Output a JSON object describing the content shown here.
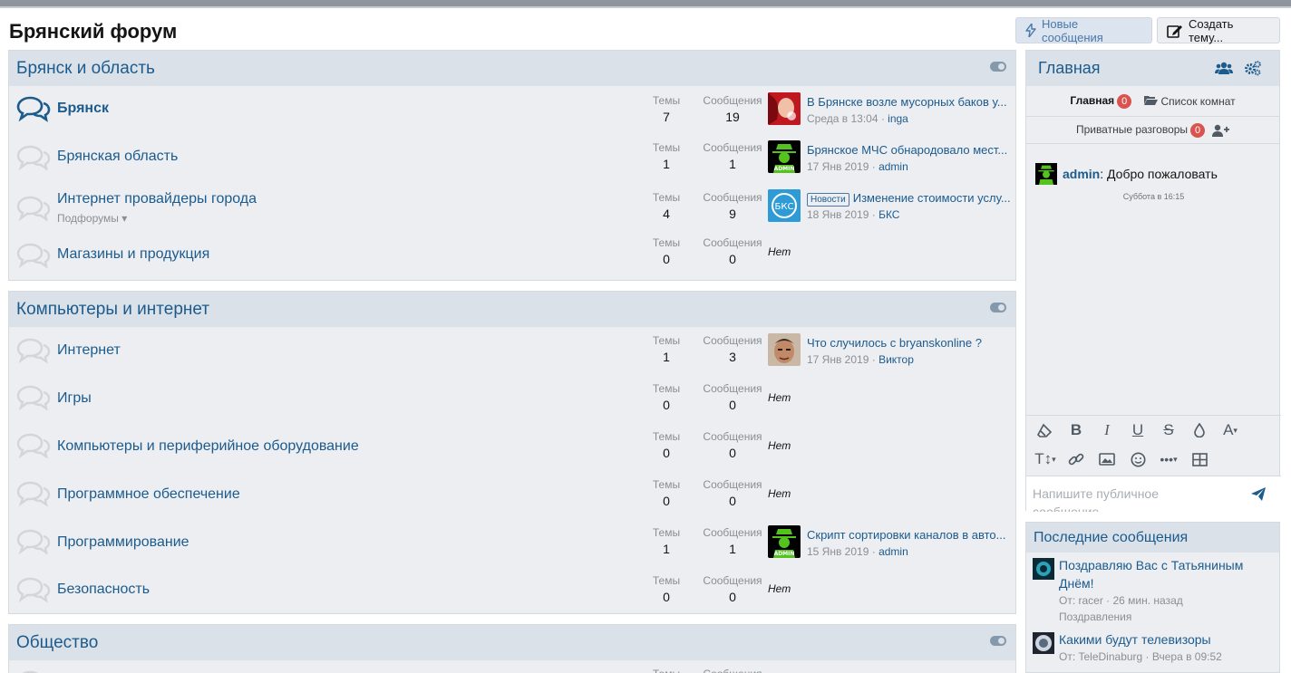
{
  "page": {
    "title": "Брянский форум"
  },
  "buttons": {
    "new_posts": "Новые сообщения",
    "create_thread": "Создать тему..."
  },
  "labels": {
    "threads": "Темы",
    "messages": "Сообщения",
    "none": "Нет"
  },
  "categories": [
    {
      "title": "Брянск и область",
      "nodes": [
        {
          "title": "Брянск",
          "unread": true,
          "threads": "7",
          "messages": "19",
          "last": {
            "title": "В Брянске возле мусорных баков у...",
            "date": "Среда в 13:04",
            "user": "inga",
            "avatar": "red-avatar"
          }
        },
        {
          "title": "Брянская область",
          "threads": "1",
          "messages": "1",
          "last": {
            "title": "Брянское МЧС обнародовало мест...",
            "date": "17 Янв 2019",
            "user": "admin",
            "avatar": "admin-avatar"
          }
        },
        {
          "title": "Интернет провайдеры города",
          "subforums": "Подфорумы",
          "threads": "4",
          "messages": "9",
          "last": {
            "prefix": "Новости",
            "title": "Изменение стоимости услу...",
            "date": "18 Янв 2019",
            "user": "БКС",
            "avatar": "bks-avatar",
            "avatar_text": "БКС"
          }
        },
        {
          "title": "Магазины и продукция",
          "threads": "0",
          "messages": "0"
        }
      ]
    },
    {
      "title": "Компьютеры и интернет",
      "nodes": [
        {
          "title": "Интернет",
          "threads": "1",
          "messages": "3",
          "last": {
            "title": "Что случилось с bryanskonline ?",
            "date": "17 Янв 2019",
            "user": "Виктор",
            "avatar": "face-avatar"
          }
        },
        {
          "title": "Игры",
          "threads": "0",
          "messages": "0"
        },
        {
          "title": "Компьютеры и периферийное оборудование",
          "threads": "0",
          "messages": "0"
        },
        {
          "title": "Программное обеспечение",
          "threads": "0",
          "messages": "0"
        },
        {
          "title": "Программирование",
          "threads": "1",
          "messages": "1",
          "last": {
            "title": "Скрипт сортировки каналов в авто...",
            "date": "15 Янв 2019",
            "user": "admin",
            "avatar": "admin-avatar"
          }
        },
        {
          "title": "Безопасность",
          "threads": "0",
          "messages": "0"
        }
      ]
    },
    {
      "title": "Общество",
      "nodes": [
        {
          "title": "",
          "threads": "",
          "messages": ""
        }
      ]
    }
  ],
  "admin_badge": "ADMIN",
  "chat": {
    "title": "Главная",
    "tab_main": "Главная",
    "tab_main_count": "0",
    "tab_rooms": "Список комнат",
    "tab_private": "Приватные разговоры",
    "tab_private_count": "0",
    "message_user": "admin",
    "message_text": ": Добро пожаловать",
    "message_time": "Суббота в 16:15",
    "input_placeholder": "Напишите публичное сообщение"
  },
  "latest": {
    "title": "Последние сообщения",
    "posts": [
      {
        "title": "Поздравляю Вас с Татьяниным Днём!",
        "meta": "От: racer · 26 мин. назад",
        "forum": "Поздравления"
      },
      {
        "title": "Какими будут телевизоры",
        "meta": "От: TeleDinaburg · Вчера в 09:52"
      }
    ]
  },
  "colors": {
    "accent": "#1c5b8d",
    "header_bg": "#dbe1e8",
    "block_bg": "#eceef1",
    "badge": "#d9534f"
  }
}
